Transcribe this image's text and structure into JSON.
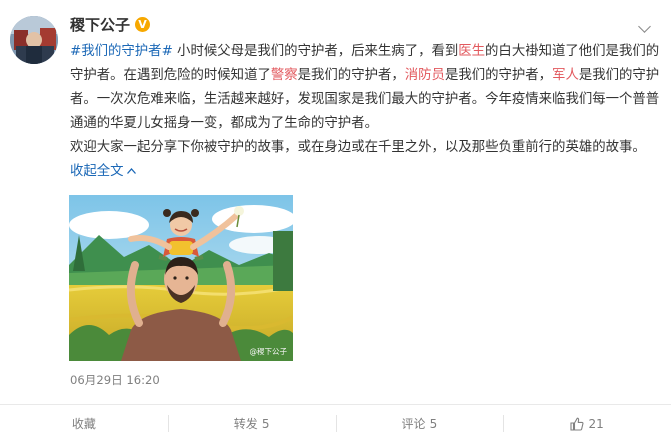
{
  "post": {
    "author": "稷下公子",
    "verified_badge": "V",
    "topic": "#我们的守护者#",
    "text_1": " 小时候父母是我们的守护者，后来生病了，看到",
    "kw_doctor": "医生",
    "text_2": "的白大褂知道了他们是我们的守护者。在遇到危险的时候知道了",
    "kw_police": "警察",
    "text_3": "是我们的守护者，",
    "kw_firefighter": "消防员",
    "text_4": "是我们的守护者，",
    "kw_soldier": "军人",
    "text_5": "是我们的守护者。一次次危难来临，生活越来越好，发现国家是我们最大的守护者。今年疫情来临我们每一个普普通通的华夏儿女摇身一变，都成为了生命的守护者。",
    "para2": "欢迎大家一起分享下你被守护的故事，或在身边或在千里之外，以及那些负重前行的英雄的故事。",
    "expand_label": "收起全文",
    "image_watermark": "@稷下公子",
    "timestamp": "06月29日 16:20"
  },
  "actions": {
    "favorite_label": "收藏",
    "repost_label": "转发",
    "repost_count": "5",
    "comment_label": "评论",
    "comment_count": "5",
    "like_count": "21"
  },
  "colors": {
    "link": "#1a67b6",
    "keyword": "#e2595e",
    "badge": "#f7a800"
  },
  "icons": [
    "verified-badge-icon",
    "chevron-down-icon",
    "thumbs-up-icon",
    "expand-arrow-icon"
  ]
}
